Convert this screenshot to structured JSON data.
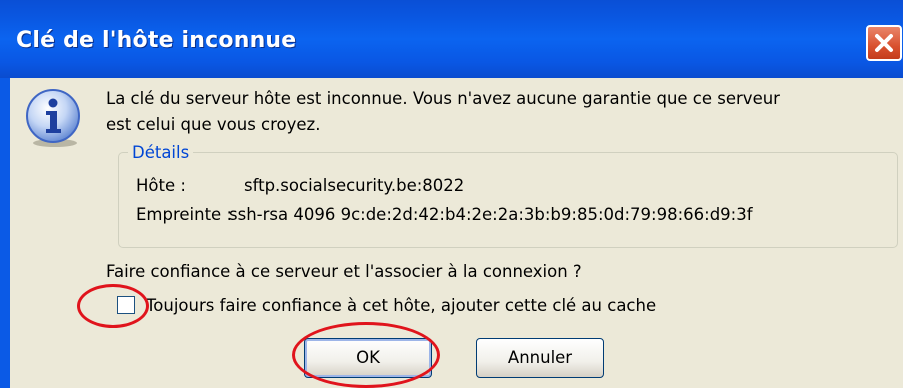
{
  "window": {
    "title": "Clé de l'hôte inconnue"
  },
  "message": {
    "line1": "La clé du serveur hôte est inconnue. Vous n'avez aucune garantie que ce serveur",
    "line2": "est celui que vous croyez."
  },
  "details": {
    "legend": "Détails",
    "host_key": "Hôte :",
    "host_value": "sftp.socialsecurity.be:8022",
    "fingerprint_key": "Empreinte :",
    "fingerprint_value": "ssh-rsa 4096 9c:de:2d:42:b4:2e:2a:3b:b9:85:0d:79:98:66:d9:3f"
  },
  "trust": {
    "question": "Faire confiance à ce serveur et l'associer à la connexion ?",
    "checkbox_label": "Toujours faire confiance à cet hôte, ajouter cette clé au cache",
    "checked": false
  },
  "buttons": {
    "ok": "OK",
    "cancel": "Annuler"
  },
  "icons": {
    "info": "info-icon",
    "close": "close-icon"
  },
  "colors": {
    "titlebar": "#0b5ae6",
    "dialog_bg": "#ece9d8",
    "close_button": "#d9512f",
    "legend_text": "#0046d5",
    "annotation": "#e0141c"
  }
}
